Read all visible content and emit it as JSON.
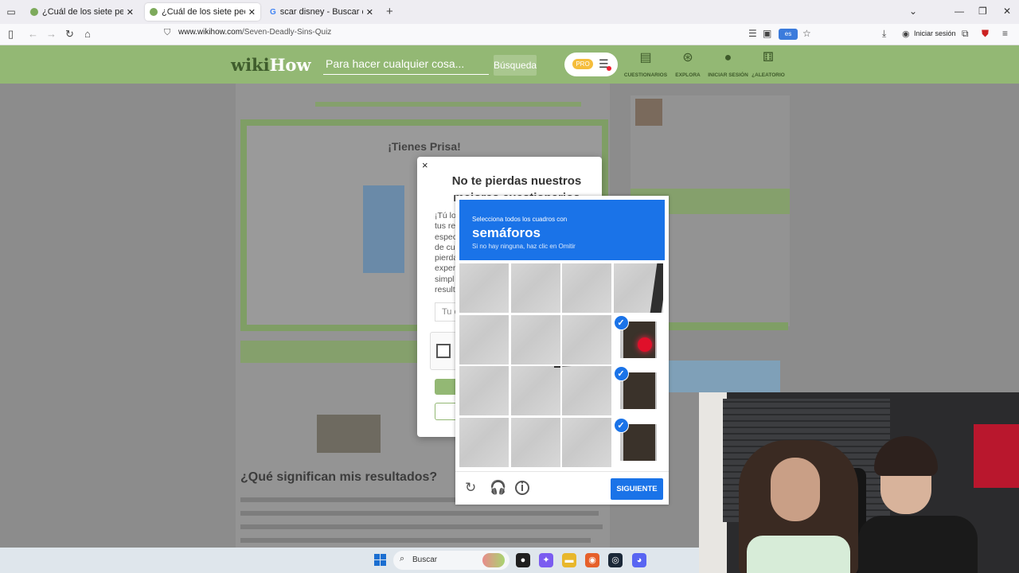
{
  "browser": {
    "tabs": [
      {
        "label": "¿Cuál de los siete pecados capi",
        "active": false
      },
      {
        "label": "¿Cuál de los siete pecados capi",
        "active": true
      },
      {
        "label": "scar disney - Buscar con Google",
        "active": false
      }
    ],
    "url_host": "www.wikihow.com",
    "url_path": "/Seven-Deadly-Sins-Quiz",
    "translate_badge": "es",
    "signin_label": "Iniciar sesión",
    "extension_badge": "20"
  },
  "wikihow": {
    "logo_wiki": "wiki",
    "logo_how": "How",
    "search_placeholder": "Para hacer cualquier cosa...",
    "search_button": "Búsqueda",
    "pro_label": "PRO",
    "nav": [
      {
        "label": "CUESTIONARIOS",
        "icon": "quiz-icon"
      },
      {
        "label": "EXPLORA",
        "icon": "compass-icon"
      },
      {
        "label": "INICIAR SESIÓN",
        "icon": "user-icon"
      },
      {
        "label": "¿ALEATORIO",
        "icon": "dice-icon"
      }
    ],
    "card_title": "¡Tienes Prisa!",
    "page_heading": "¿Qué significan mis resultados?"
  },
  "modal": {
    "close": "×",
    "title": "No te pierdas nuestros mejores cuestionarios",
    "body_lines": [
      "¡Tú lo",
      "tus re",
      "espec",
      "de cu",
      "pierda",
      "exper",
      "simpl",
      "result"
    ],
    "email_placeholder": "Tu e"
  },
  "captcha": {
    "instruction_small": "Selecciona todos los cuadros con",
    "instruction_target": "semáforos",
    "instruction_hint": "Si no hay ninguna, haz clic en Omitir",
    "selected_cells": [
      7,
      11,
      15
    ],
    "next_button": "SIGUIENTE",
    "icons": [
      "reload-icon",
      "headphones-icon",
      "info-icon"
    ]
  },
  "taskbar": {
    "search_label": "Buscar",
    "apps": [
      {
        "name": "github-icon",
        "color": "#1f1f1f"
      },
      {
        "name": "copilot-icon",
        "color": "#7b5cf0"
      },
      {
        "name": "file-explorer-icon",
        "color": "#e8b72c"
      },
      {
        "name": "firefox-icon",
        "color": "#e6602a"
      },
      {
        "name": "steam-icon",
        "color": "#1b2838"
      },
      {
        "name": "discord-icon",
        "color": "#5865f2"
      }
    ]
  }
}
